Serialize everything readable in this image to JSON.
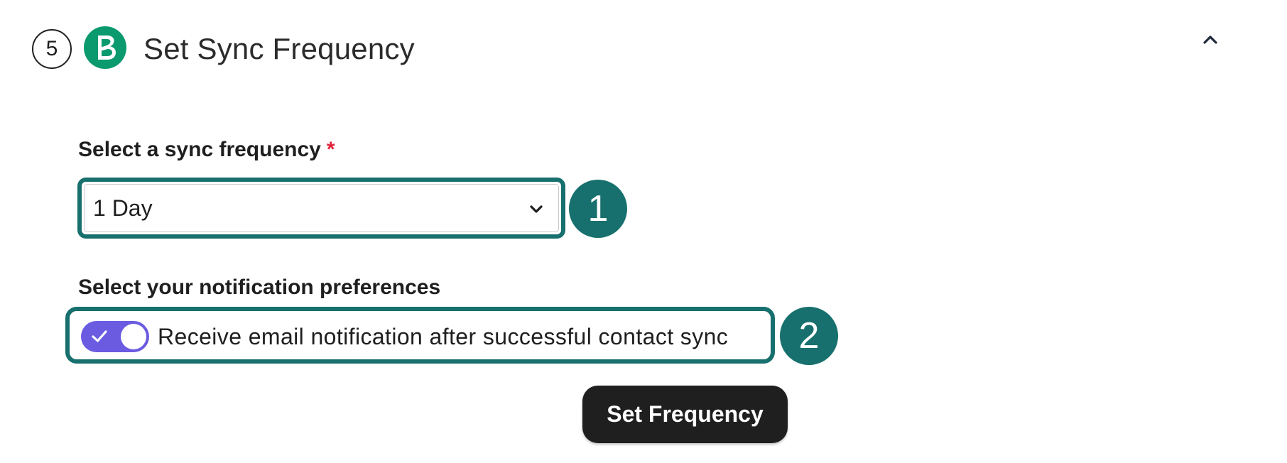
{
  "header": {
    "step_number": "5",
    "title": "Set Sync Frequency",
    "brand_icon": "brevo-b-logo-icon",
    "collapse_icon": "chevron-up-icon"
  },
  "frequency": {
    "label": "Select a sync frequency",
    "required_marker": "*",
    "selected_value": "1 Day",
    "dropdown_icon": "chevron-down-icon"
  },
  "notifications": {
    "label": "Select your notification preferences",
    "toggle_on": true,
    "toggle_label": "Receive email notification after successful contact sync"
  },
  "callouts": [
    "1",
    "2"
  ],
  "actions": {
    "submit_label": "Set Frequency"
  },
  "colors": {
    "callout_teal": "#17706d",
    "brand_green": "#0b996e",
    "toggle_purple": "#6a5be1",
    "required_red": "#e0223a",
    "button_dark": "#1f1f1f"
  }
}
